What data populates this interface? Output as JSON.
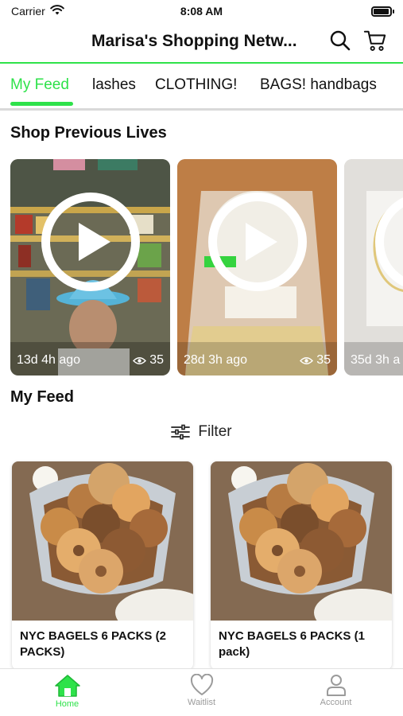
{
  "status_bar": {
    "carrier": "Carrier",
    "time": "8:08 AM",
    "battery_level": 0.95
  },
  "header": {
    "title": "Marisa's Shopping Netw...",
    "search_icon": "search-icon",
    "cart_icon": "cart-icon"
  },
  "tabs": [
    {
      "label": "My Feed",
      "active": true
    },
    {
      "label": "lashes"
    },
    {
      "label": "CLOTHING!"
    },
    {
      "label": "BAGS! handbags"
    }
  ],
  "previous_lives": {
    "title": "Shop Previous Lives",
    "items": [
      {
        "age": "13d 4h ago",
        "views": "35"
      },
      {
        "age": "28d 3h ago",
        "views": "35"
      },
      {
        "age": "35d 3h a"
      }
    ]
  },
  "feed": {
    "title": "My Feed",
    "filter_label": "Filter",
    "products": [
      {
        "name": "NYC BAGELS 6 PACKS (2 PACKS)"
      },
      {
        "name": "NYC BAGELS 6 PACKS (1 pack)"
      }
    ]
  },
  "tabbar": [
    {
      "label": "Home",
      "icon": "home-icon",
      "active": true
    },
    {
      "label": "Waitlist",
      "icon": "heart-icon"
    },
    {
      "label": "Account",
      "icon": "user-icon"
    }
  ],
  "colors": {
    "accent": "#2ee24a",
    "text": "#111111",
    "muted": "#9b9b9b"
  }
}
